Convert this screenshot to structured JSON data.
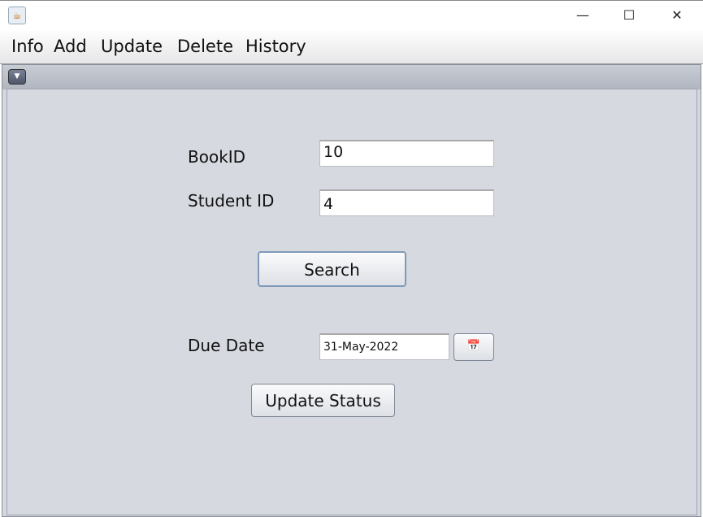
{
  "window": {
    "min": "—",
    "max": "☐",
    "close": "✕"
  },
  "menu": [
    "Info",
    "Add",
    "Update",
    "Delete",
    "History"
  ],
  "form": {
    "book_id_label": "BookID",
    "book_id_value": "10",
    "student_id_label": "Student ID",
    "student_id_value": "4",
    "search_label": "Search",
    "due_date_label": "Due Date",
    "due_date_value": "31-May-2022",
    "update_label": "Update Status"
  }
}
